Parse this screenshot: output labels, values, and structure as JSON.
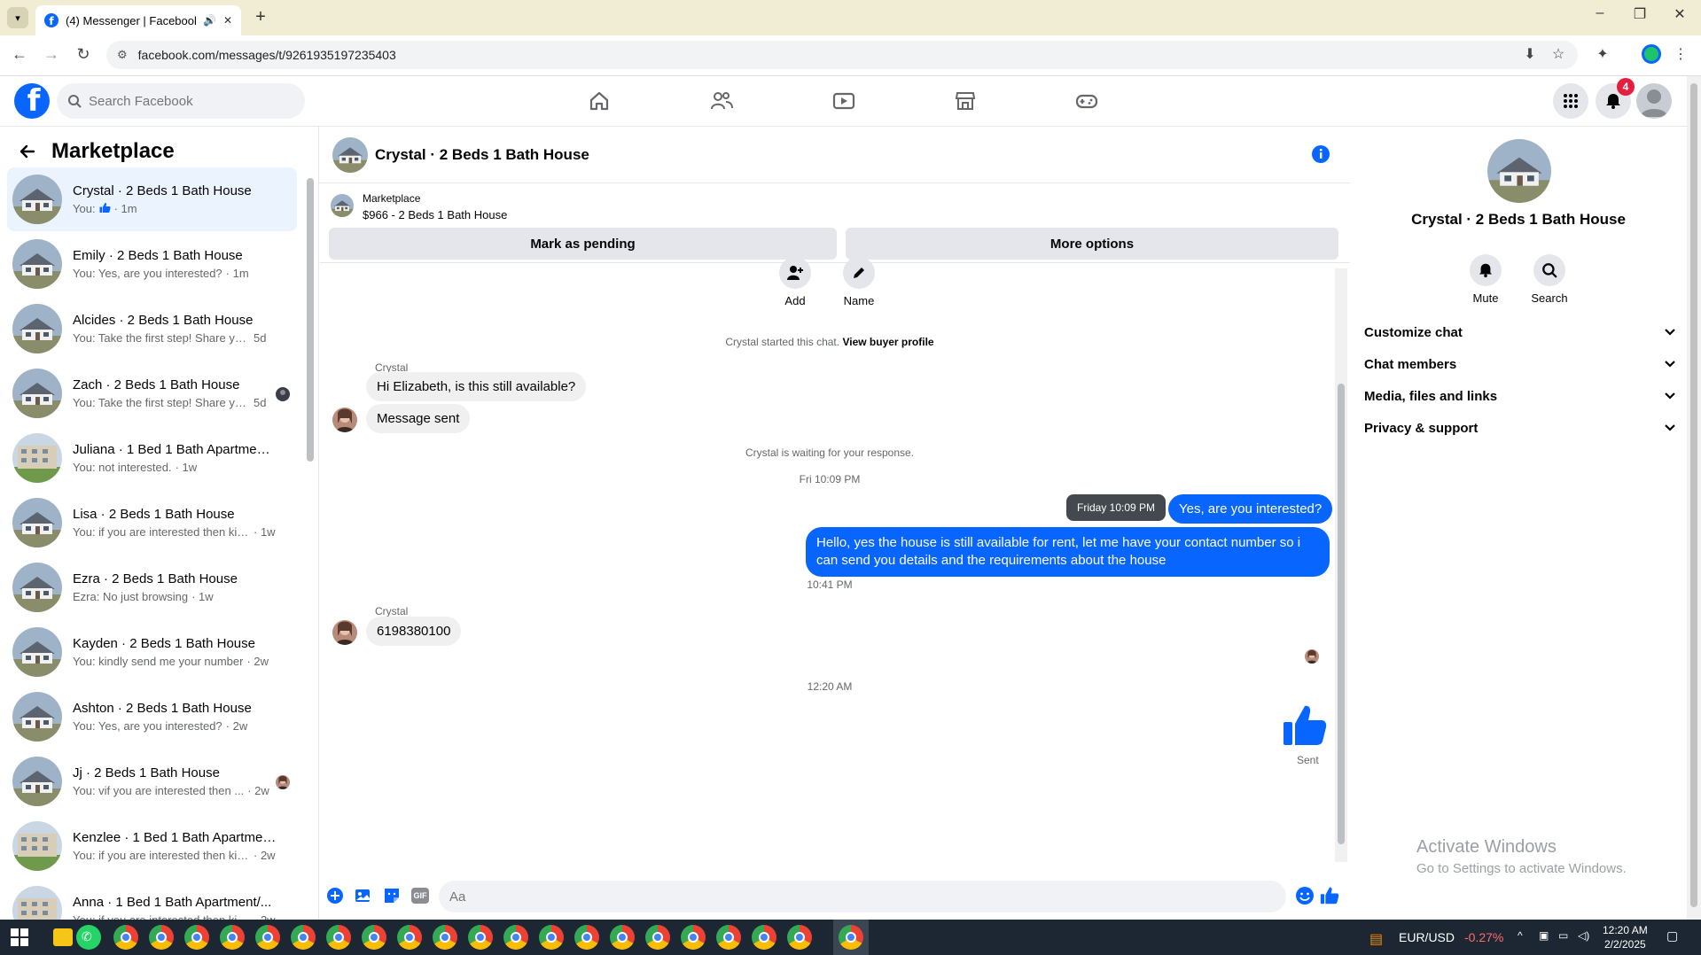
{
  "browser": {
    "tab_title": "(4) Messenger | Facebook",
    "url": "facebook.com/messages/t/9261935197235403"
  },
  "fb": {
    "search_placeholder": "Search Facebook",
    "notification_count": "4"
  },
  "left": {
    "title": "Marketplace",
    "conversations": [
      {
        "name": "Crystal · 2 Beds 1 Bath House",
        "preview": "You: ",
        "time": "· 1m",
        "thumb": true
      },
      {
        "name": "Emily · 2 Beds 1 Bath House",
        "preview": "You: Yes, are you interested?",
        "time": "· 1m"
      },
      {
        "name": "Alcides · 2 Beds 1 Bath House",
        "preview": "You: Take the first step! Share your ...",
        "time": "5d"
      },
      {
        "name": "Zach · 2 Beds 1 Bath House",
        "preview": "You: Take the first step! Share yo...",
        "time": "5d"
      },
      {
        "name": "Juliana · 1 Bed 1 Bath Apartment...",
        "preview": "You: not interested.",
        "time": "· 1w"
      },
      {
        "name": "Lisa · 2 Beds 1 Bath House",
        "preview": "You: if you are interested then kin...",
        "time": "· 1w"
      },
      {
        "name": "Ezra · 2 Beds 1 Bath House",
        "preview": "Ezra: No just browsing",
        "time": "· 1w"
      },
      {
        "name": "Kayden · 2 Beds 1 Bath House",
        "preview": "You: kindly send me your number",
        "time": "· 2w"
      },
      {
        "name": "Ashton · 2 Beds 1 Bath House",
        "preview": "You: Yes, are you interested?",
        "time": "· 2w"
      },
      {
        "name": "Jj · 2 Beds 1 Bath House",
        "preview": "You: vif you are interested then ...",
        "time": "· 2w"
      },
      {
        "name": "Kenzlee · 1 Bed 1 Bath Apartmen...",
        "preview": "You: if you are interested then kind...",
        "time": "· 2w"
      },
      {
        "name": "Anna · 1 Bed 1 Bath Apartment/...",
        "preview": "You: if you are interested then kind...",
        "time": "· 2w"
      }
    ]
  },
  "chat": {
    "title": "Crystal · 2 Beds 1 Bath House",
    "marketplace_label": "Marketplace",
    "listing": "$966 - 2 Beds 1 Bath House",
    "mark_pending": "Mark as pending",
    "more_options": "More options",
    "add_label": "Add",
    "name_label": "Name",
    "started_text": "Crystal started this chat.",
    "view_profile": "View buyer profile",
    "sender": "Crystal",
    "msg1": "Hi Elizabeth, is this still available?",
    "msg2": "Message sent",
    "waiting": "Crystal is waiting for your response.",
    "ts1": "Fri 10:09 PM",
    "tooltip": "Friday 10:09 PM",
    "out1": "Yes, are you interested?",
    "out2": "Hello, yes the house is still available for rent, let me have your contact number so i can send you details and the requirements about the house",
    "ts2": "10:41 PM",
    "msg3": "6198380100",
    "ts3": "12:20 AM",
    "sent": "Sent",
    "composer_placeholder": "Aa"
  },
  "right": {
    "title": "Crystal · 2 Beds 1 Bath House",
    "mute": "Mute",
    "search": "Search",
    "sections": [
      "Customize chat",
      "Chat members",
      "Media, files and links",
      "Privacy & support"
    ],
    "activate_title": "Activate Windows",
    "activate_sub": "Go to Settings to activate Windows."
  },
  "taskbar": {
    "ticker": "EUR/USD",
    "ticker_change": "-0.27%",
    "time": "12:20 AM",
    "date": "2/2/2025"
  },
  "colors": {
    "fb_blue": "#0866ff",
    "active_row": "#ebf3ff",
    "bubble_in": "#f0f0f0",
    "negative": "#ff6b6b"
  }
}
